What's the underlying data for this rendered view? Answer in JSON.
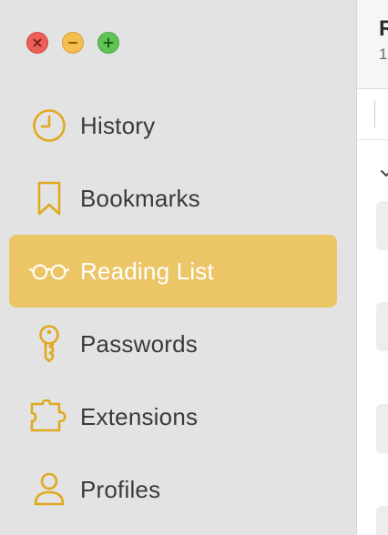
{
  "window": {
    "controls": {
      "close": "close",
      "minimize": "minimize",
      "zoom": "zoom"
    }
  },
  "sidebar": {
    "items": [
      {
        "label": "History",
        "icon": "clock-icon",
        "selected": false
      },
      {
        "label": "Bookmarks",
        "icon": "bookmark-icon",
        "selected": false
      },
      {
        "label": "Reading List",
        "icon": "glasses-icon",
        "selected": true
      },
      {
        "label": "Passwords",
        "icon": "key-icon",
        "selected": false
      },
      {
        "label": "Extensions",
        "icon": "puzzle-icon",
        "selected": false
      },
      {
        "label": "Profiles",
        "icon": "person-icon",
        "selected": false
      }
    ]
  },
  "content": {
    "title": "R",
    "subtitle": "1"
  },
  "colors": {
    "accent": "#ecc566",
    "icon": "#e0a91e",
    "sidebar_bg": "#e3e3e3"
  }
}
